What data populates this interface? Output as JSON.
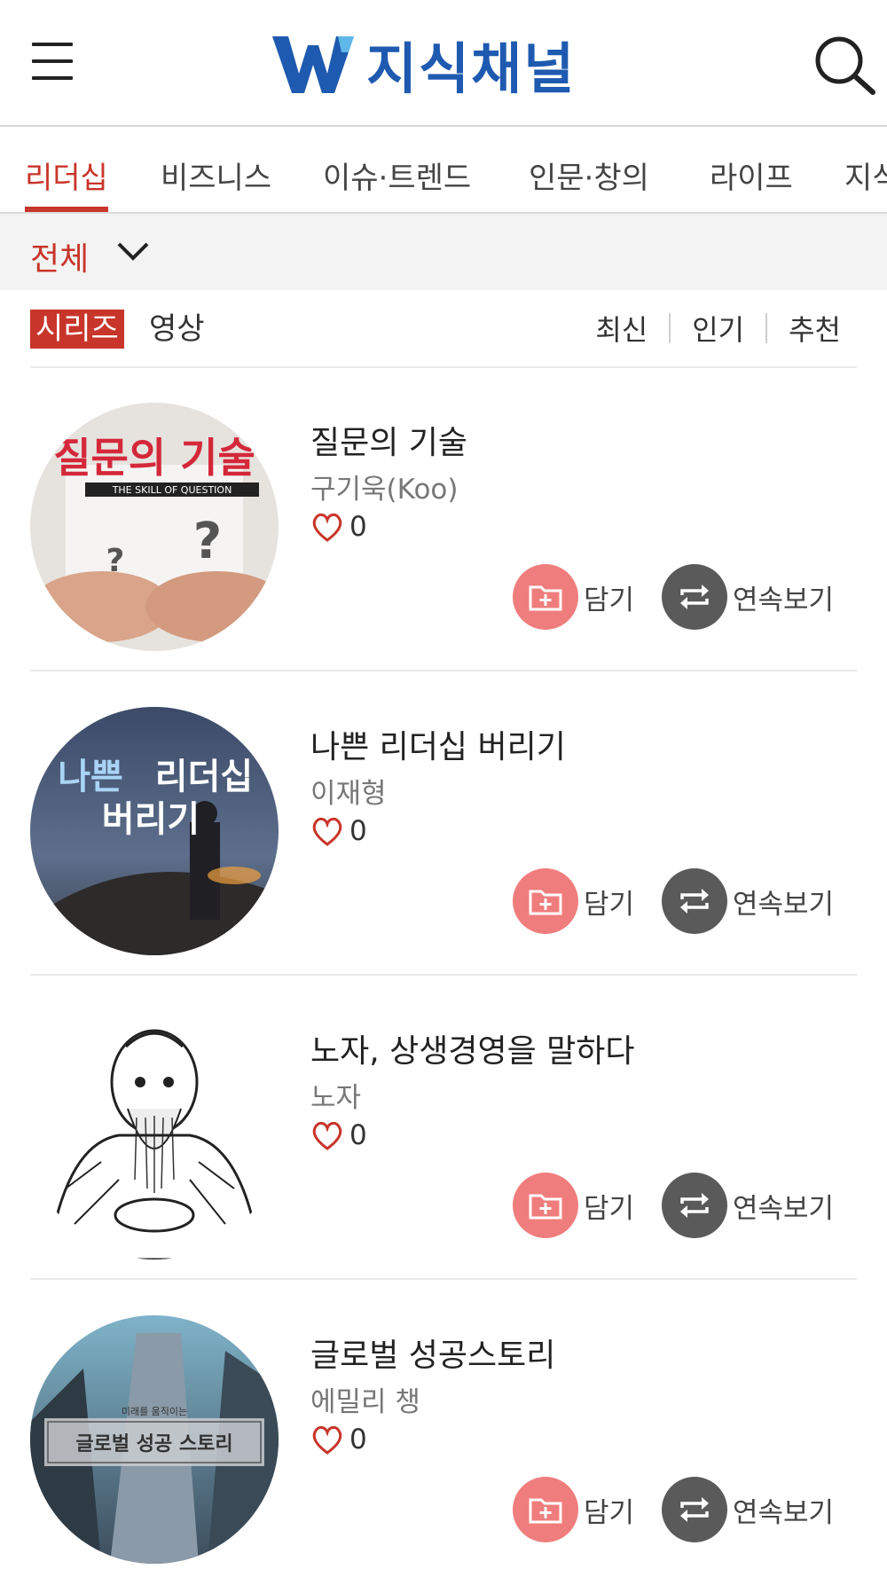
{
  "header": {
    "logo_text": "지식채널",
    "brand_color": "#1e5ab0",
    "menu_icon": "hamburger-icon",
    "search_icon": "search-icon"
  },
  "tabs": [
    {
      "label": "리더십",
      "active": true
    },
    {
      "label": "비즈니스",
      "active": false
    },
    {
      "label": "이슈·트렌드",
      "active": false
    },
    {
      "label": "인문·창의",
      "active": false
    },
    {
      "label": "라이프",
      "active": false
    },
    {
      "label": "지식",
      "active": false
    }
  ],
  "accent_color": "#c8352a",
  "filter": {
    "label": "전체"
  },
  "subtabs": {
    "series": "시리즈",
    "video": "영상"
  },
  "sorts": [
    "최신",
    "인기",
    "추천"
  ],
  "buttons": {
    "save": "담기",
    "play": "연속보기"
  },
  "items": [
    {
      "title": "질문의 기술",
      "author": "구기욱(Koo)",
      "likes": "0",
      "thumb_text": "질문의 기술",
      "thumb_sub": "THE SKILL OF QUESTION"
    },
    {
      "title": "나쁜 리더십 버리기",
      "author": "이재형",
      "likes": "0",
      "thumb_text_a": "나쁜",
      "thumb_text_b": "리더십",
      "thumb_text_c": "버리기"
    },
    {
      "title": "노자, 상생경영을 말하다",
      "author": "노자",
      "likes": "0"
    },
    {
      "title": "글로벌 성공스토리",
      "author": "에밀리 챙",
      "likes": "0",
      "thumb_small": "미래를 움직이는",
      "thumb_text": "글로벌 성공 스토리"
    }
  ]
}
